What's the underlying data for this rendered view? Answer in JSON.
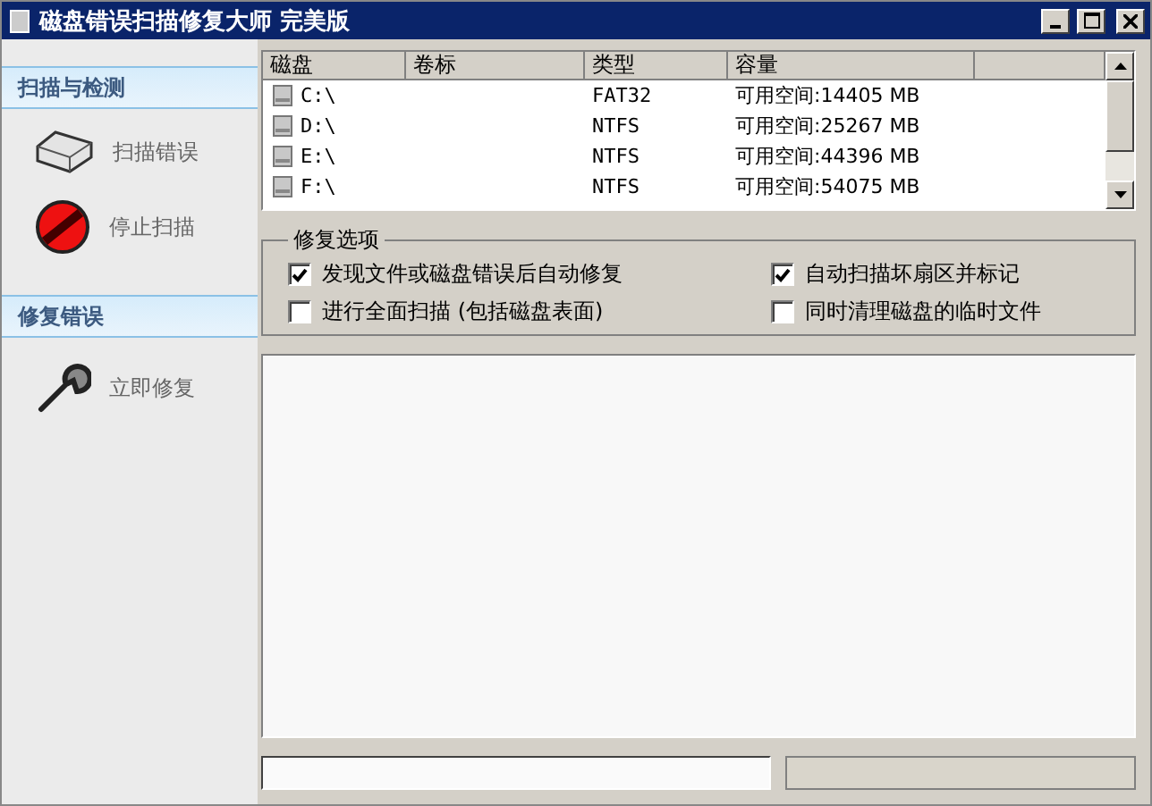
{
  "window": {
    "title": "磁盘错误扫描修复大师  完美版"
  },
  "sidebar": {
    "sections": [
      {
        "title": "扫描与检测",
        "items": [
          {
            "label": "扫描错误",
            "kind": "disk"
          },
          {
            "label": "停止扫描",
            "kind": "stop"
          }
        ]
      },
      {
        "title": "修复错误",
        "items": [
          {
            "label": "立即修复",
            "kind": "wrench"
          }
        ]
      }
    ]
  },
  "drive_list": {
    "columns": [
      "磁盘",
      "卷标",
      "类型",
      "容量"
    ],
    "rows": [
      {
        "drive": "C:\\",
        "type": "FAT32",
        "capacity": "可用空间:14405 MB"
      },
      {
        "drive": "D:\\",
        "type": "NTFS",
        "capacity": "可用空间:25267 MB"
      },
      {
        "drive": "E:\\",
        "type": "NTFS",
        "capacity": "可用空间:44396 MB"
      },
      {
        "drive": "F:\\",
        "type": "NTFS",
        "capacity": "可用空间:54075 MB"
      }
    ]
  },
  "repair_options": {
    "title": "修复选项",
    "options": [
      {
        "label": "发现文件或磁盘错误后自动修复",
        "checked": true
      },
      {
        "label": "自动扫描坏扇区并标记",
        "checked": true
      },
      {
        "label": "进行全面扫描 (包括磁盘表面)",
        "checked": false
      },
      {
        "label": "同时清理磁盘的临时文件",
        "checked": false
      }
    ]
  }
}
